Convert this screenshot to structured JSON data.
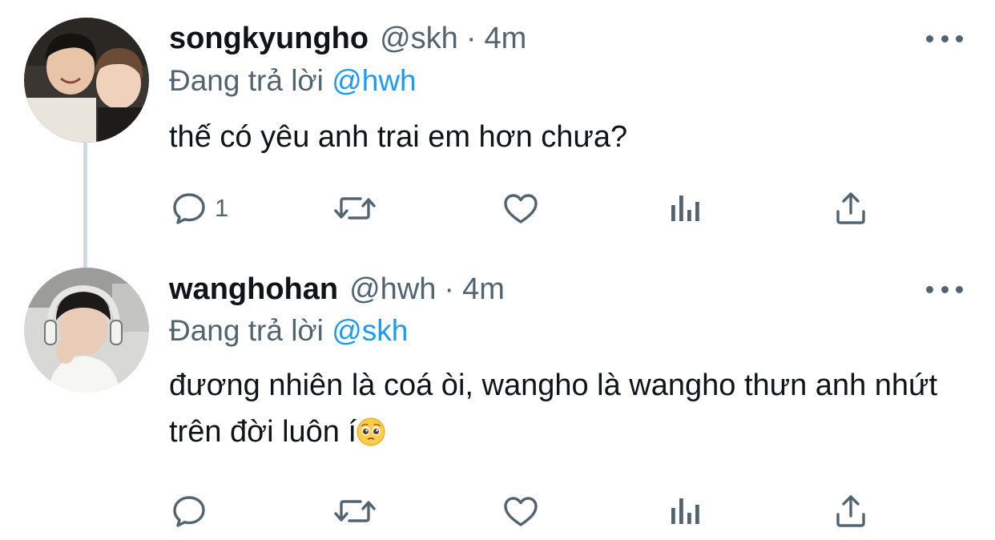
{
  "tweets": [
    {
      "display_name": "songkyungho",
      "handle": "@skh",
      "separator": "·",
      "timestamp": "4m",
      "reply_prefix": "Đang trả lời",
      "reply_mention": "@hwh",
      "text": "thế có yêu anh trai em hơn chưa?",
      "actions": {
        "reply_count": "1"
      }
    },
    {
      "display_name": "wanghohan",
      "handle": "@hwh",
      "separator": "·",
      "timestamp": "4m",
      "reply_prefix": "Đang trả lời",
      "reply_mention": "@skh",
      "text": "đương nhiên là coá òi, wangho là wangho thưn anh nhứt trên đời luôn í",
      "emoji": "pleading-face-emoji",
      "actions": {
        "reply_count": ""
      }
    }
  ],
  "icons": {
    "reply": "reply-icon",
    "retweet": "retweet-icon",
    "like": "like-icon",
    "analytics": "analytics-icon",
    "share": "share-icon",
    "more": "more-icon"
  },
  "colors": {
    "text": "#0f1419",
    "secondary": "#536471",
    "link": "#1d9bf0",
    "thread_line": "#cfd9de"
  }
}
